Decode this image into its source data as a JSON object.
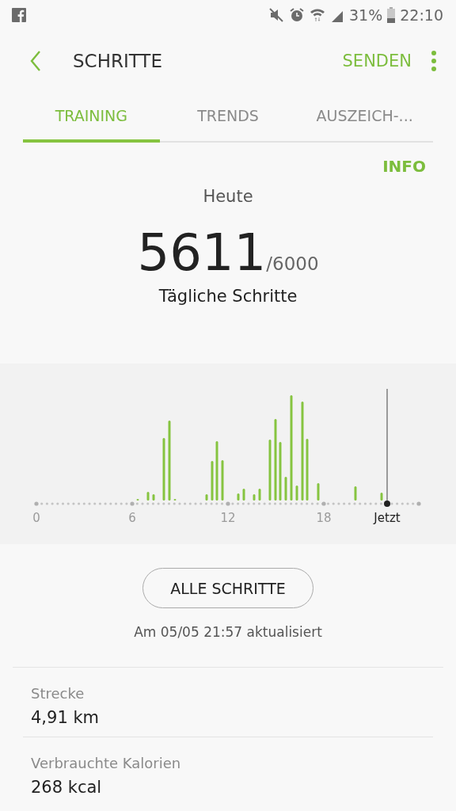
{
  "status_bar": {
    "battery": "31%",
    "time": "22:10"
  },
  "app_bar": {
    "title": "SCHRITTE",
    "action": "SENDEN"
  },
  "tabs": [
    {
      "label": "TRAINING",
      "selected": true
    },
    {
      "label": "TRENDS",
      "selected": false
    },
    {
      "label": "AUSZEICH-...",
      "selected": false
    }
  ],
  "info_link": "INFO",
  "summary": {
    "period": "Heute",
    "steps": "5611",
    "goal": "/6000",
    "caption": "Tägliche Schritte"
  },
  "chart": {
    "x_labels": [
      "0",
      "6",
      "12",
      "18"
    ],
    "now_label": "Jetzt"
  },
  "all_steps_button": "ALLE SCHRITTE",
  "updated": "Am 05/05 21:57 aktualisiert",
  "stats": [
    {
      "label": "Strecke",
      "value": "4,91 km"
    },
    {
      "label": "Verbrauchte Kalorien",
      "value": "268 kcal"
    }
  ]
}
